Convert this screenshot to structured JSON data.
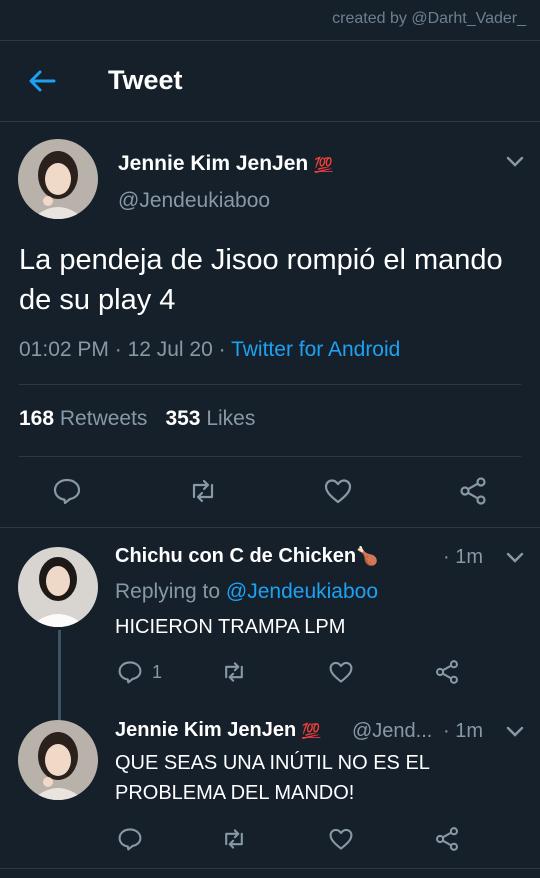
{
  "watermark": "created by @Darht_Vader_",
  "header": {
    "title": "Tweet"
  },
  "tweet": {
    "author_name": "Jennie Kim JenJen",
    "author_emoji": "💯",
    "author_handle": "@Jendeukiaboo",
    "text": "La pendeja de Jisoo rompió el mando de su play 4",
    "time": "01:02 PM",
    "date": "12 Jul 20",
    "client": "Twitter for Android",
    "retweets_count": "168",
    "retweets_label": "Retweets",
    "likes_count": "353",
    "likes_label": "Likes"
  },
  "replies": [
    {
      "author_name": "Chichu con C de Chicken",
      "author_emoji": "🍗",
      "time": "1m",
      "replying_to_label": "Replying to",
      "replying_to_handle": "@Jendeukiaboo",
      "text": "HICIERON TRAMPA LPM",
      "reply_count": "1"
    },
    {
      "author_name": "Jennie Kim JenJen",
      "author_emoji": "💯",
      "author_handle": "@Jend...",
      "time": "1m",
      "text": "QUE SEAS UNA INÚTIL NO ES EL PROBLEMA DEL MANDO!"
    }
  ],
  "colors": {
    "background": "#15202b",
    "accent": "#1da1f2",
    "secondary_text": "#8899a6",
    "divider": "#2b3946"
  }
}
